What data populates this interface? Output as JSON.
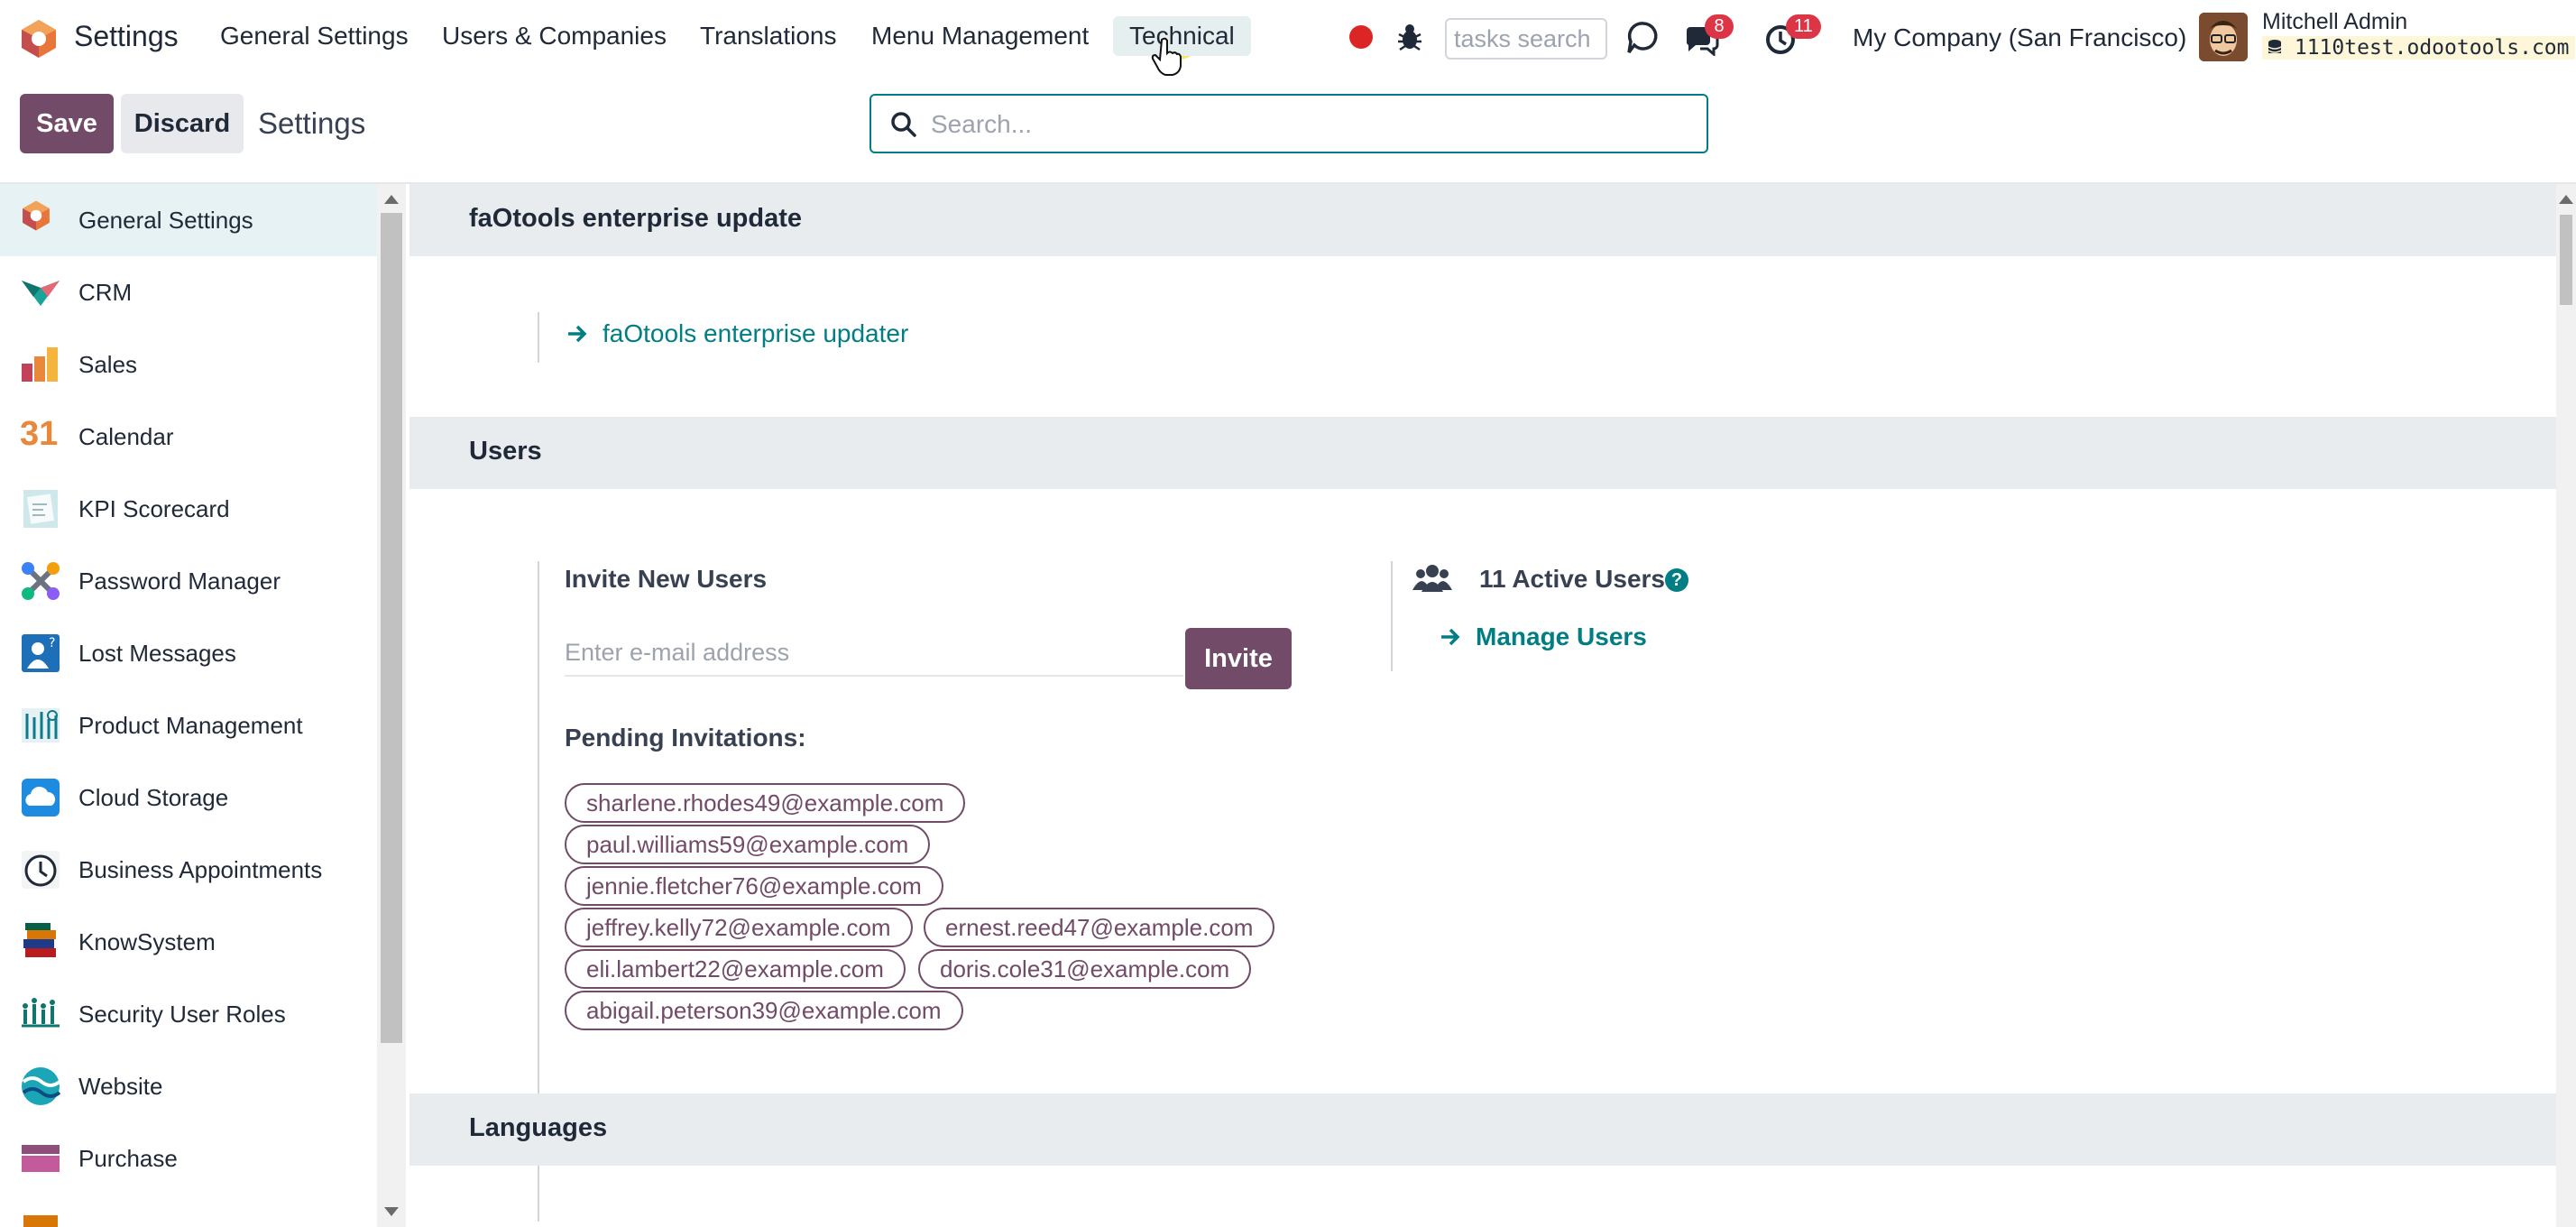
{
  "navbar": {
    "brand": "Settings",
    "menus": [
      "General Settings",
      "Users & Companies",
      "Translations",
      "Menu Management",
      "Technical"
    ],
    "tasks_search_placeholder": "tasks search",
    "messages_count": "8",
    "activities_count": "11",
    "company": "My Company (San Francisco)",
    "user_name": "Mitchell Admin",
    "database": "1110test.odootools.com"
  },
  "control_panel": {
    "save_label": "Save",
    "discard_label": "Discard",
    "title": "Settings",
    "search_placeholder": "Search..."
  },
  "sidebar": {
    "items": [
      {
        "label": "General Settings",
        "icon": "general-settings-icon"
      },
      {
        "label": "CRM",
        "icon": "crm-icon"
      },
      {
        "label": "Sales",
        "icon": "sales-icon"
      },
      {
        "label": "Calendar",
        "icon": "calendar-icon"
      },
      {
        "label": "KPI Scorecard",
        "icon": "kpi-scorecard-icon"
      },
      {
        "label": "Password Manager",
        "icon": "password-manager-icon"
      },
      {
        "label": "Lost Messages",
        "icon": "lost-messages-icon"
      },
      {
        "label": "Product Management",
        "icon": "product-management-icon"
      },
      {
        "label": "Cloud Storage",
        "icon": "cloud-storage-icon"
      },
      {
        "label": "Business Appointments",
        "icon": "business-appointments-icon"
      },
      {
        "label": "KnowSystem",
        "icon": "knowsystem-icon"
      },
      {
        "label": "Security User Roles",
        "icon": "security-user-roles-icon"
      },
      {
        "label": "Website",
        "icon": "website-icon"
      },
      {
        "label": "Purchase",
        "icon": "purchase-icon"
      }
    ],
    "calendar_glyph": "31"
  },
  "main": {
    "sections": {
      "faotools": {
        "title": "faOtools enterprise update",
        "link": "faOtools enterprise updater"
      },
      "users": {
        "title": "Users",
        "invite_title": "Invite New Users",
        "email_placeholder": "Enter e-mail address",
        "invite_label": "Invite",
        "pending_title": "Pending Invitations:",
        "pending": [
          "sharlene.rhodes49@example.com",
          "paul.williams59@example.com",
          "jennie.fletcher76@example.com",
          "jeffrey.kelly72@example.com",
          "ernest.reed47@example.com",
          "eli.lambert22@example.com",
          "doris.cole31@example.com",
          "abigail.peterson39@example.com"
        ],
        "active_users": "11 Active Users",
        "manage_users": "Manage Users",
        "help_glyph": "?"
      },
      "languages": {
        "title": "Languages"
      }
    }
  },
  "colors": {
    "primary": "#714b67",
    "link": "#017e84",
    "badge": "#dc3545",
    "section_bg": "#e9ecef"
  }
}
